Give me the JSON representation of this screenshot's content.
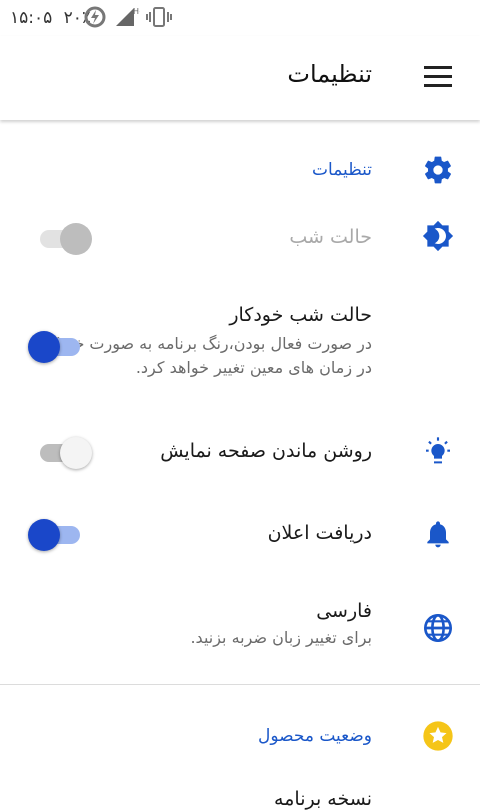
{
  "status_bar": {
    "time": "۱۵:۰۵",
    "battery": "۲۰٪",
    "network_label": "H+"
  },
  "header": {
    "title": "تنظیمات"
  },
  "settings": {
    "section_title": "تنظیمات",
    "night_mode": {
      "label": "حالت شب"
    },
    "auto_night_mode": {
      "label": "حالت شب خودکار",
      "summary": "در صورت فعال بودن،رنگ برنامه به صورت خودکار در زمان های معین تغییر خواهد کرد."
    },
    "keep_screen_on": {
      "label": "روشن ماندن صفحه نمایش"
    },
    "notifications": {
      "label": "دریافت اعلان"
    },
    "language": {
      "label": "فارسی",
      "summary": "برای تغییر زبان ضربه بزنید."
    }
  },
  "product_status": {
    "title": "وضعیت محصول"
  },
  "partial_row": {
    "label": "نسخه برنامه"
  },
  "colors": {
    "accent": "#1a57c9",
    "toggle_on": "#1a47c9",
    "star": "#f5c518"
  }
}
